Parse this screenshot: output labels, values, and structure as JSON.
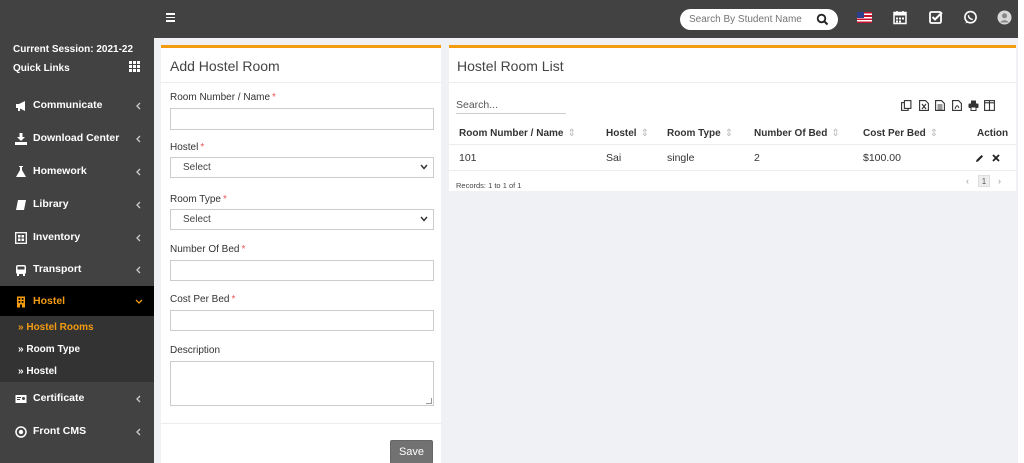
{
  "topbar": {
    "search_placeholder": "Search By Student Name",
    "icons": [
      "menu-icon",
      "search-icon",
      "us-flag-icon",
      "calendar-icon",
      "checkbox-icon",
      "whatsapp-icon",
      "user-avatar-icon"
    ]
  },
  "sidebar": {
    "session": "Current Session: 2021-22",
    "quick_links": "Quick Links",
    "items": [
      {
        "label": "Communicate",
        "icon": "bullhorn-icon"
      },
      {
        "label": "Download Center",
        "icon": "download-icon"
      },
      {
        "label": "Homework",
        "icon": "flask-icon"
      },
      {
        "label": "Library",
        "icon": "book-icon"
      },
      {
        "label": "Inventory",
        "icon": "inventory-icon"
      },
      {
        "label": "Transport",
        "icon": "bus-icon"
      },
      {
        "label": "Hostel",
        "icon": "building-icon",
        "active": true
      },
      {
        "label": "Certificate",
        "icon": "certificate-icon"
      },
      {
        "label": "Front CMS",
        "icon": "globe-icon"
      }
    ],
    "hostel_sub": [
      "Hostel Rooms",
      "Room Type",
      "Hostel"
    ]
  },
  "add_form": {
    "title": "Add Hostel Room",
    "room_number_label": "Room Number / Name",
    "hostel_label": "Hostel",
    "hostel_value": "Select",
    "room_type_label": "Room Type",
    "room_type_value": "Select",
    "beds_label": "Number Of Bed",
    "cost_label": "Cost Per Bed",
    "description_label": "Description",
    "required_mark": "*",
    "save_label": "Save"
  },
  "room_list": {
    "title": "Hostel Room List",
    "search_placeholder": "Search...",
    "columns": [
      "Room Number / Name",
      "Hostel",
      "Room Type",
      "Number Of Bed",
      "Cost Per Bed",
      "Action"
    ],
    "rows": [
      {
        "room": "101",
        "hostel": "Sai",
        "type": "single",
        "beds": "2",
        "cost": "$100.00"
      }
    ],
    "records": "Records: 1 to 1 of 1",
    "page": "1",
    "prev": "‹",
    "next": "›",
    "tool_icons": [
      "copy-icon",
      "excel-icon",
      "csv-icon",
      "pdf-icon",
      "print-icon",
      "columns-icon"
    ]
  },
  "colors": {
    "sidebar": "#424242",
    "accent": "#f39c12",
    "content_bg": "#f0f1f4"
  }
}
